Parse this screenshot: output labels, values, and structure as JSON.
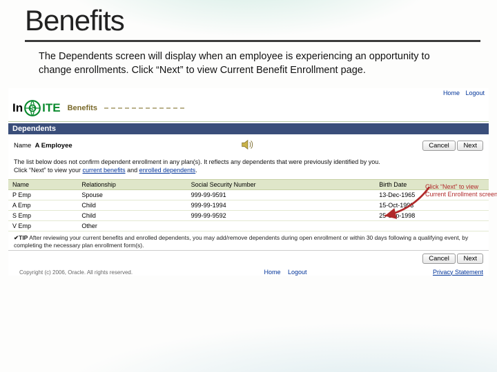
{
  "slide": {
    "title": "Benefits",
    "intro": "The Dependents screen will display when an employee is experiencing an opportunity to change enrollments.  Click “Next” to view Current Benefit Enrollment page."
  },
  "header": {
    "home": "Home",
    "logout": "Logout",
    "logo_prefix": "In",
    "logo_suffix": "ITE",
    "breadcrumb": "Benefits"
  },
  "section": {
    "title": "Dependents"
  },
  "nameRow": {
    "label": "Name",
    "value": "A Employee"
  },
  "buttons": {
    "cancel": "Cancel",
    "next": "Next"
  },
  "help": {
    "line1": "The list below does not confirm dependent enrollment in any plan(s). It reflects any dependents that were previously identified by you.",
    "line2_pre": "Click “Next” to view your ",
    "link1": "current benefits",
    "mid": " and ",
    "link2": "enrolled dependents",
    "period": "."
  },
  "table": {
    "cols": {
      "name": "Name",
      "rel": "Relationship",
      "ssn": "Social Security Number",
      "dob": "Birth Date"
    },
    "rows": [
      {
        "name": "P Emp",
        "rel": "Spouse",
        "ssn": "999-99-9591",
        "dob": "13-Dec-1965"
      },
      {
        "name": "A Emp",
        "rel": "Child",
        "ssn": "999-99-1994",
        "dob": "15-Oct-1993"
      },
      {
        "name": "S Emp",
        "rel": "Child",
        "ssn": "999-99-9592",
        "dob": "25-Sep-1998"
      },
      {
        "name": "V Emp",
        "rel": "Other",
        "ssn": "",
        "dob": ""
      }
    ]
  },
  "tip": {
    "label": "TIP",
    "text": " After reviewing your current benefits and enrolled dependents, you may add/remove dependents during open enrollment or within 30 days following a qualifying event, by completing the necessary plan enrollment form(s)."
  },
  "footer": {
    "home": "Home",
    "logout": "Logout",
    "privacy": "Privacy Statement",
    "copyright": "Copyright (c) 2006, Oracle. All rights reserved."
  },
  "callout": "Click “Next” to view Current Enrollment screen"
}
